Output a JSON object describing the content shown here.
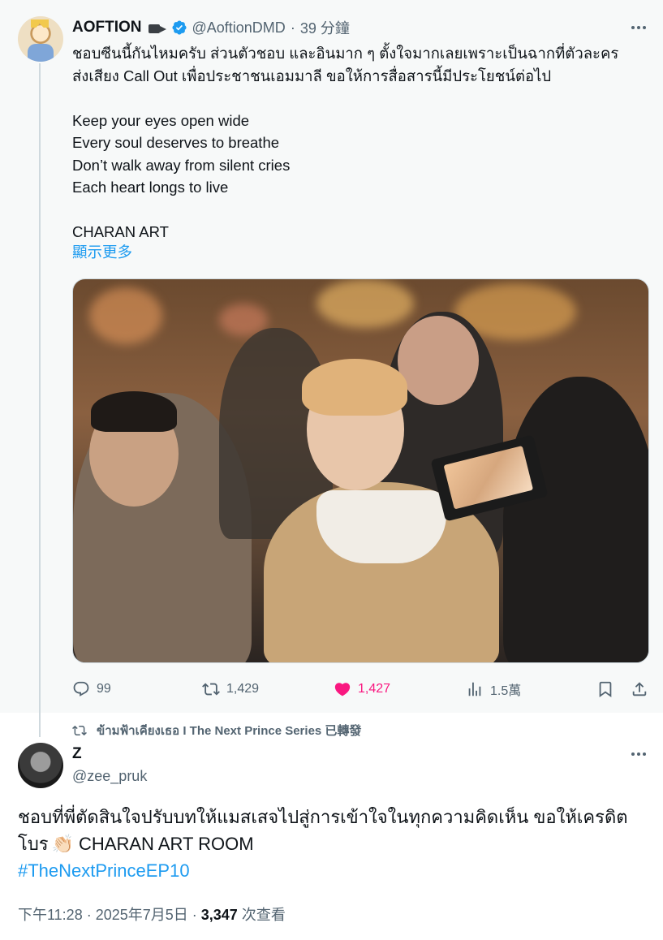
{
  "original": {
    "display_name": "AOFTION",
    "handle": "@AoftionDMD",
    "separator": "·",
    "time": "39 分鐘",
    "text_lines": [
      "ชอบซีนนี้กันไหมครับ ส่วนตัวชอบ และอินมาก ๆ  ตั้งใจมากเลยเพราะเป็นฉากที่ตัวละคร",
      "ส่งเสียง Call Out เพื่อประชาชนเอมมาลี ขอให้การสื่อสารนี้มีประโยชน์ต่อไป",
      "",
      "Keep your eyes open wide",
      "Every soul deserves to breathe",
      "Don’t walk away from silent cries",
      "Each heart longs to live",
      "",
      "CHARAN ART"
    ],
    "show_more": "顯示更多",
    "stats": {
      "replies": "99",
      "retweets": "1,429",
      "likes": "1,427",
      "views": "1.5萬"
    }
  },
  "retweet_banner": "ข้ามฟ้าเคียงเธอ I The Next Prince Series 已轉發",
  "reply": {
    "display_name": "Z",
    "handle": "@zee_pruk",
    "line1": "ชอบที่พี่ตัดสินใจปรับบทให้แมสเสจไปสู่การเข้าใจในทุกความคิดเห็น ขอให้เครดิต",
    "line2_prefix": "โบร",
    "clap_emoji": "👏🏻",
    "line2_suffix": "CHARAN ART ROOM",
    "hashtag": "#TheNextPrinceEP10",
    "time": "下午11:28 · 2025年7月5日 · ",
    "views_count": "3,347",
    "views_label": " 次查看"
  },
  "colors": {
    "accent": "#1d9bf0",
    "like": "#f91880",
    "secondary_text": "#536471",
    "parent_bg": "#f7f9f9"
  },
  "icons": [
    "camera-icon",
    "verified-icon",
    "more-icon",
    "reply-icon",
    "retweet-icon",
    "like-icon",
    "views-icon",
    "bookmark-icon",
    "share-icon"
  ]
}
